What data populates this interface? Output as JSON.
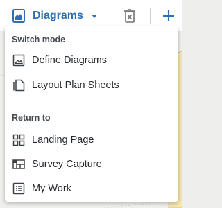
{
  "toolbar": {
    "mode_label": "Diagrams",
    "mode_icon": "diagram-image-icon",
    "caret_icon": "caret-down-icon",
    "trash_icon": "delete-icon",
    "add_icon": "plus-icon",
    "accent_color": "#2f6fb3"
  },
  "menu": {
    "sections": [
      {
        "title": "Switch mode",
        "items": [
          {
            "label": "Define Diagrams",
            "icon": "diagram-image-icon"
          },
          {
            "label": "Layout Plan Sheets",
            "icon": "sheets-icon"
          }
        ]
      },
      {
        "title": "Return to",
        "items": [
          {
            "label": "Landing Page",
            "icon": "grid-icon"
          },
          {
            "label": "Survey Capture",
            "icon": "survey-capture-icon"
          },
          {
            "label": "My Work",
            "icon": "list-icon"
          }
        ]
      }
    ]
  }
}
